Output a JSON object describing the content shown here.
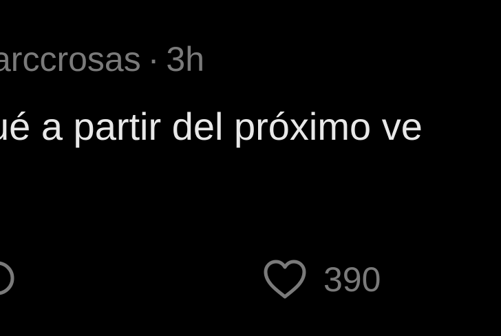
{
  "post": {
    "username": "arccrosas",
    "separator": "·",
    "time_ago": "3h",
    "text": "ué a partir del próximo ve",
    "actions": {
      "left_icon": "comment-icon",
      "like_icon": "heart-icon",
      "like_count": "390"
    },
    "colors": {
      "background": "#000000",
      "text": "#e8e8e8",
      "muted": "#7a7a7a"
    }
  }
}
